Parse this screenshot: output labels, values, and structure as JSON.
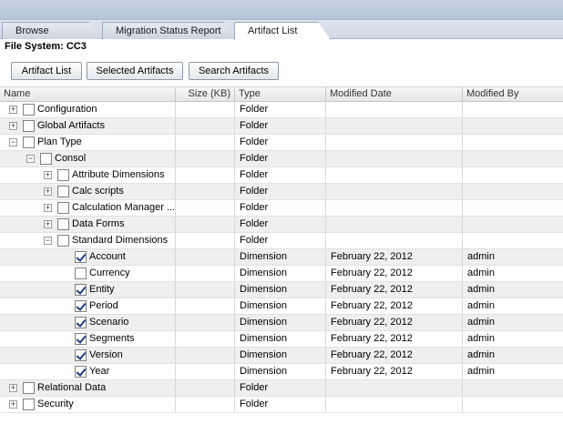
{
  "tabs": {
    "browse": "Browse",
    "migration": "Migration Status Report",
    "artifact": "Artifact List"
  },
  "file_system": "File System:  CC3",
  "buttons": {
    "artifact_list": "Artifact List",
    "selected_artifacts": "Selected Artifacts",
    "search_artifacts": "Search Artifacts"
  },
  "columns": {
    "name": "Name",
    "size": "Size (KB)",
    "type": "Type",
    "modified_date": "Modified Date",
    "modified_by": "Modified By"
  },
  "rows": [
    {
      "name": "Configuration",
      "type": "Folder",
      "date": "",
      "by": ""
    },
    {
      "name": "Global Artifacts",
      "type": "Folder",
      "date": "",
      "by": ""
    },
    {
      "name": "Plan Type",
      "type": "Folder",
      "date": "",
      "by": ""
    },
    {
      "name": "Consol",
      "type": "Folder",
      "date": "",
      "by": ""
    },
    {
      "name": "Attribute Dimensions",
      "type": "Folder",
      "date": "",
      "by": ""
    },
    {
      "name": "Calc scripts",
      "type": "Folder",
      "date": "",
      "by": ""
    },
    {
      "name": "Calculation Manager ...",
      "type": "Folder",
      "date": "",
      "by": ""
    },
    {
      "name": "Data Forms",
      "type": "Folder",
      "date": "",
      "by": ""
    },
    {
      "name": "Standard Dimensions",
      "type": "Folder",
      "date": "",
      "by": ""
    },
    {
      "name": "Account",
      "type": "Dimension",
      "date": "February 22, 2012",
      "by": "admin",
      "checked": true
    },
    {
      "name": "Currency",
      "type": "Dimension",
      "date": "February 22, 2012",
      "by": "admin",
      "checked": false
    },
    {
      "name": "Entity",
      "type": "Dimension",
      "date": "February 22, 2012",
      "by": "admin",
      "checked": true
    },
    {
      "name": "Period",
      "type": "Dimension",
      "date": "February 22, 2012",
      "by": "admin",
      "checked": true
    },
    {
      "name": "Scenario",
      "type": "Dimension",
      "date": "February 22, 2012",
      "by": "admin",
      "checked": true
    },
    {
      "name": "Segments",
      "type": "Dimension",
      "date": "February 22, 2012",
      "by": "admin",
      "checked": true
    },
    {
      "name": "Version",
      "type": "Dimension",
      "date": "February 22, 2012",
      "by": "admin",
      "checked": true
    },
    {
      "name": "Year",
      "type": "Dimension",
      "date": "February 22, 2012",
      "by": "admin",
      "checked": true
    },
    {
      "name": "Relational Data",
      "type": "Folder",
      "date": "",
      "by": ""
    },
    {
      "name": "Security",
      "type": "Folder",
      "date": "",
      "by": ""
    }
  ],
  "icons": {
    "expand": "plus-expander-icon",
    "collapse": "minus-expander-icon",
    "checkbox": "checkbox-icon"
  }
}
